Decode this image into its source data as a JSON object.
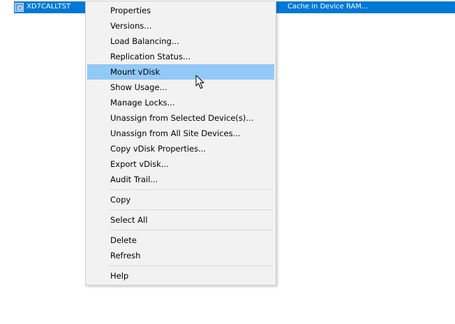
{
  "list_row": {
    "name": "XD7CALLTST",
    "cache_type": "Cache in Device RAM..."
  },
  "context_menu": {
    "groups": [
      [
        {
          "label": "Properties"
        },
        {
          "label": "Versions..."
        },
        {
          "label": "Load Balancing..."
        },
        {
          "label": "Replication Status..."
        },
        {
          "label": "Mount vDisk",
          "highlighted": true
        },
        {
          "label": "Show Usage..."
        },
        {
          "label": "Manage Locks..."
        },
        {
          "label": "Unassign from Selected Device(s)..."
        },
        {
          "label": "Unassign from All Site Devices..."
        },
        {
          "label": "Copy vDisk Properties..."
        },
        {
          "label": "Export vDisk..."
        },
        {
          "label": "Audit Trail..."
        }
      ],
      [
        {
          "label": "Copy"
        }
      ],
      [
        {
          "label": "Select All"
        }
      ],
      [
        {
          "label": "Delete"
        },
        {
          "label": "Refresh"
        }
      ],
      [
        {
          "label": "Help"
        }
      ]
    ]
  },
  "colors": {
    "selection": "#0078d7",
    "menu_background": "#f2f2f2",
    "menu_highlight": "#91c9f7"
  },
  "icons": {
    "row_icon": "vdisk-icon",
    "cursor": "mouse-pointer-icon"
  }
}
